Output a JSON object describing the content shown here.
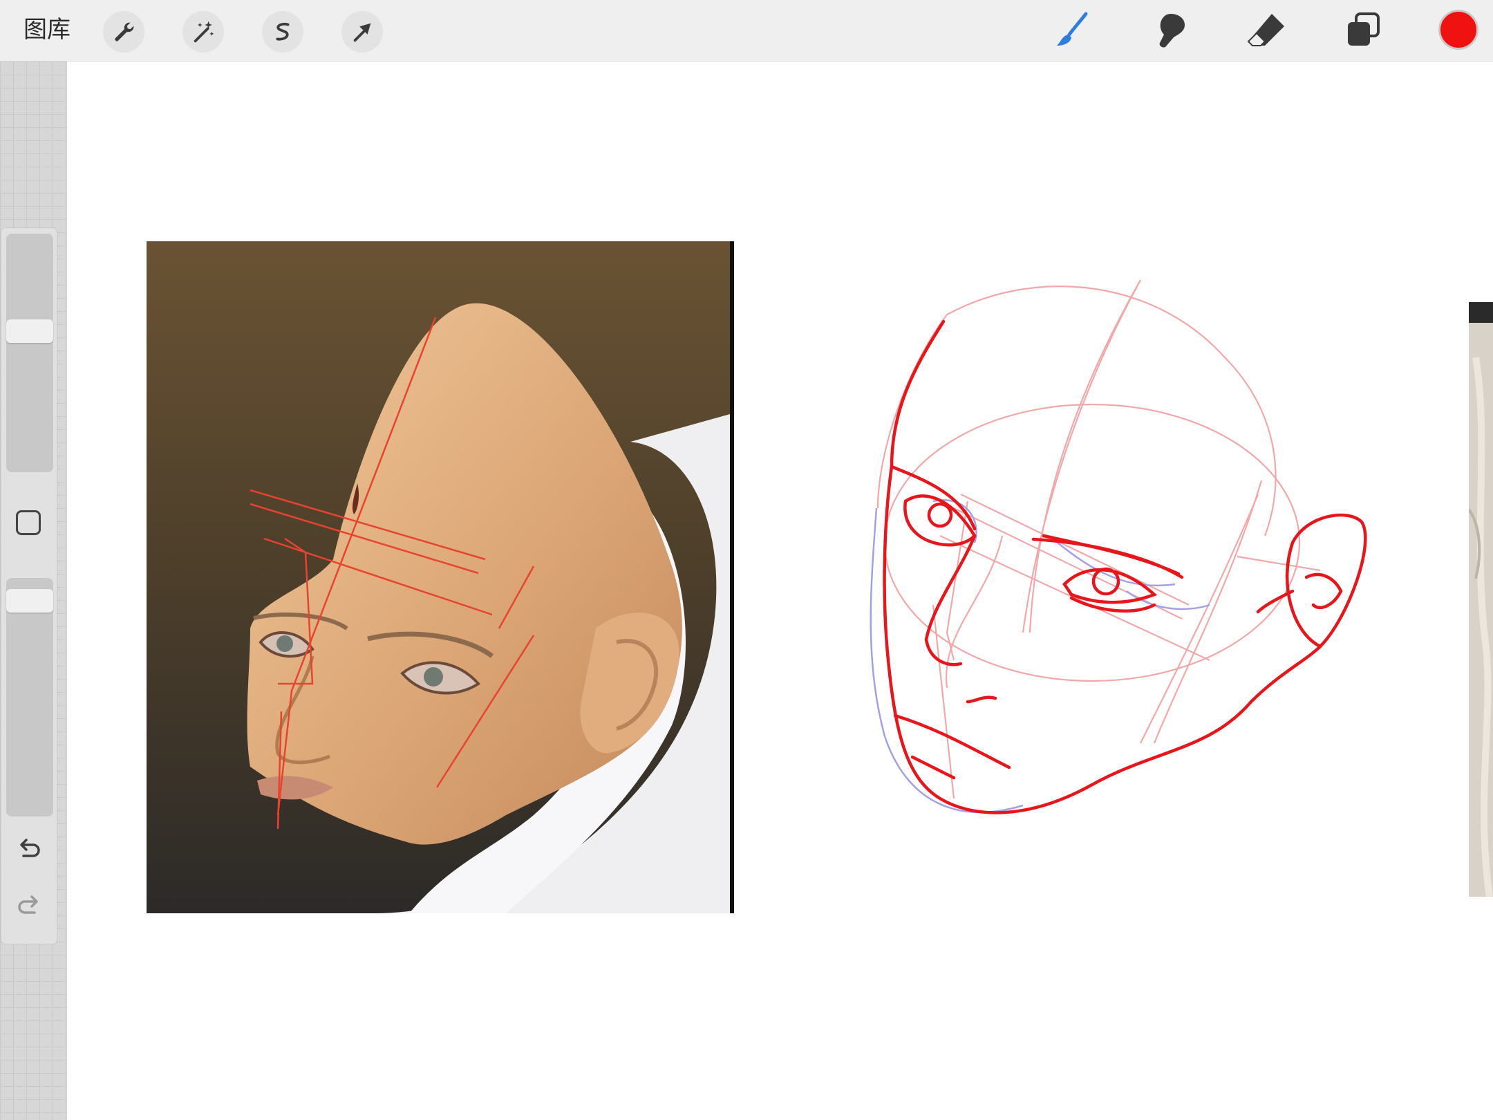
{
  "toolbar": {
    "gallery_label": "图库",
    "left_tools": [
      "wrench-icon",
      "magic-wand-icon",
      "selection-icon",
      "transform-arrow-icon"
    ],
    "right_tools": [
      "brush-icon",
      "smudge-icon",
      "eraser-icon",
      "layers-icon"
    ],
    "active_tool": "brush",
    "current_color": "#ef1210"
  },
  "sidebar": {
    "brush_size_level": 0.4,
    "opacity_level": 0.05,
    "buttons": [
      "modify-square-icon",
      "undo-icon",
      "redo-icon"
    ]
  },
  "canvas": {
    "layers_visible": [
      "reference-photo",
      "line-sketch",
      "second-reference-photo"
    ],
    "sketch_color": "#e8161a",
    "guide_color": "#f2a8a8"
  }
}
